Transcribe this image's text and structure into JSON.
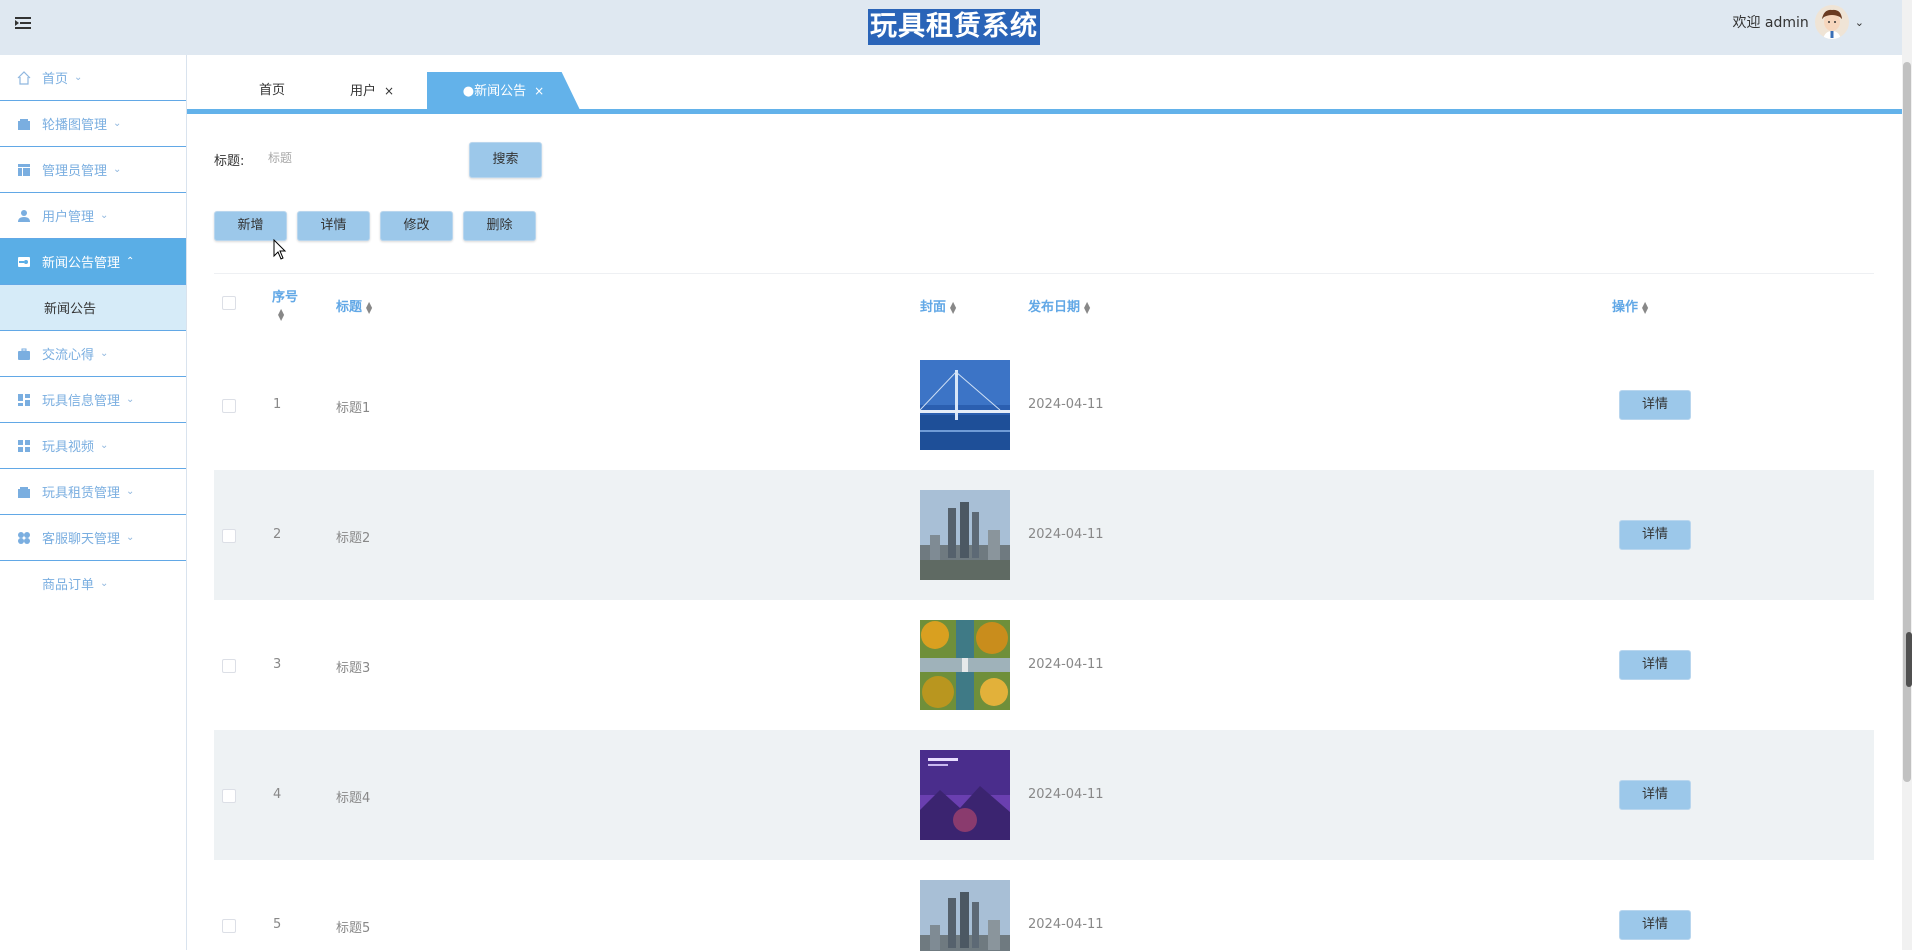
{
  "header": {
    "title": "玩具租赁系统",
    "welcome": "欢迎 admin"
  },
  "sidebar": {
    "items": [
      {
        "label": "首页",
        "icon": "home-icon"
      },
      {
        "label": "轮播图管理",
        "icon": "folder-icon"
      },
      {
        "label": "管理员管理",
        "icon": "layout-icon"
      },
      {
        "label": "用户管理",
        "icon": "user-icon"
      },
      {
        "label": "新闻公告管理",
        "icon": "card-icon",
        "active": true,
        "sub": [
          "新闻公告"
        ]
      },
      {
        "label": "交流心得",
        "icon": "briefcase-icon"
      },
      {
        "label": "玩具信息管理",
        "icon": "dashboard-icon"
      },
      {
        "label": "玩具视频",
        "icon": "grid-icon"
      },
      {
        "label": "玩具租赁管理",
        "icon": "folder-icon"
      },
      {
        "label": "客服聊天管理",
        "icon": "apps-icon"
      },
      {
        "label": "商品订单",
        "icon": ""
      }
    ]
  },
  "tabs": [
    {
      "label": "首页"
    },
    {
      "label": "用户",
      "close": "×"
    },
    {
      "label": "●新闻公告",
      "close": "×",
      "active": true
    }
  ],
  "search": {
    "label": "标题:",
    "placeholder": "标题",
    "button": "搜索"
  },
  "toolbar": {
    "add": "新增",
    "detail": "详情",
    "edit": "修改",
    "delete": "删除"
  },
  "table": {
    "columns": {
      "index": "序号",
      "title": "标题",
      "cover": "封面",
      "date": "发布日期",
      "action": "操作"
    },
    "rows": [
      {
        "index": "1",
        "title": "标题1",
        "date": "2024-04-11",
        "cover": "bridge",
        "action": "详情"
      },
      {
        "index": "2",
        "title": "标题2",
        "date": "2024-04-11",
        "cover": "city",
        "action": "详情"
      },
      {
        "index": "3",
        "title": "标题3",
        "date": "2024-04-11",
        "cover": "park",
        "action": "详情"
      },
      {
        "index": "4",
        "title": "标题4",
        "date": "2024-04-11",
        "cover": "purple-poster",
        "action": "详情"
      },
      {
        "index": "5",
        "title": "标题5",
        "date": "2024-04-11",
        "cover": "city",
        "action": "详情"
      }
    ]
  },
  "colors": {
    "accent": "#63b2ea",
    "header_bg": "#dfe8f1",
    "title_bg": "#2a64b8",
    "button_bg": "#9cc8ea"
  }
}
